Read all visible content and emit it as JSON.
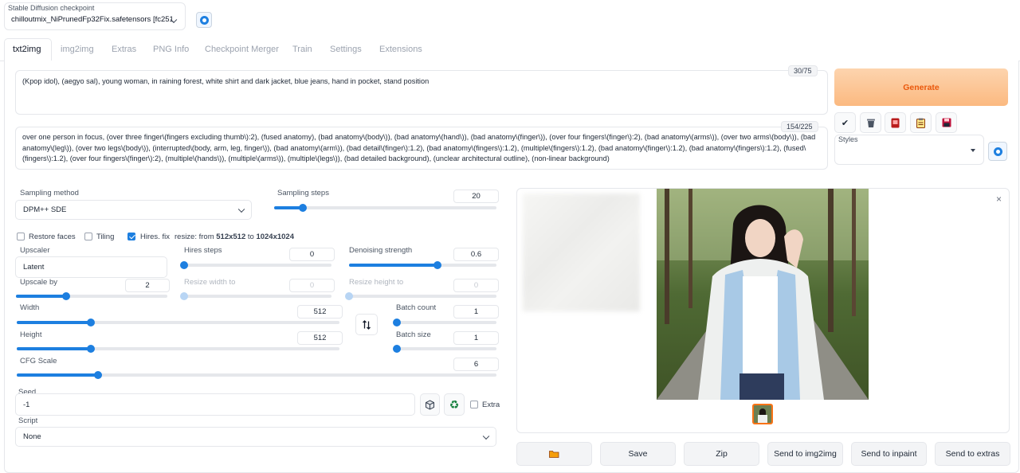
{
  "checkpoint": {
    "label": "Stable Diffusion checkpoint",
    "value": "chilloutmix_NiPrunedFp32Fix.safetensors [fc251"
  },
  "tabs": [
    "txt2img",
    "img2img",
    "Extras",
    "PNG Info",
    "Checkpoint Merger",
    "Train",
    "Settings",
    "Extensions"
  ],
  "prompt": {
    "text": "(Kpop idol), (aegyo sal),  young woman, in raining forest, white shirt and dark jacket, blue jeans, hand in pocket, stand position",
    "counter": "30/75"
  },
  "negative_prompt": {
    "text": "over one person in focus, (over three finger\\(fingers excluding thumb\\):2), (fused anatomy), (bad anatomy\\(body\\)), (bad anatomy\\(hand\\)), (bad anatomy\\(finger\\)), (over four fingers\\(finger\\):2), (bad anatomy\\(arms\\)), (over two arms\\(body\\)), (bad anatomy\\(leg\\)), (over two legs\\(body\\)), (interrupted\\(body, arm, leg, finger\\)), (bad anatomy\\(arm\\)), (bad detail\\(finger\\):1.2), (bad anatomy\\(fingers\\):1.2), (multiple\\(fingers\\):1.2), (bad anatomy\\(finger\\):1.2), (bad anatomy\\(fingers\\):1.2), (fused\\(fingers\\):1.2), (over four fingers\\(finger\\):2), (multiple\\(hands\\)), (multiple\\(arms\\)), (multiple\\(legs\\)), (bad detailed background), (unclear architectural outline), (non-linear background)",
    "counter": "154/225"
  },
  "generate_label": "Generate",
  "toolbar_icons": [
    "pencil-icon",
    "trash-icon",
    "red-card-icon",
    "clipboard-icon",
    "floppy-disk-icon"
  ],
  "styles": {
    "label": "Styles",
    "value": ""
  },
  "sampling": {
    "method_label": "Sampling method",
    "method": "DPM++ SDE",
    "steps_label": "Sampling steps",
    "steps": "20",
    "steps_fraction": 0.13
  },
  "checks": {
    "restore_faces": "Restore faces",
    "tiling": "Tiling",
    "hires_fix": "Hires. fix",
    "resize_prefix": "resize: from ",
    "resize_from": "512x512",
    "resize_to_word": " to ",
    "resize_to": "1024x1024"
  },
  "hires": {
    "upscaler_label": "Upscaler",
    "upscaler": "Latent",
    "steps_label": "Hires steps",
    "steps": "0",
    "steps_fraction": 0.0,
    "denoise_label": "Denoising strength",
    "denoise": "0.6",
    "denoise_fraction": 0.6,
    "upscale_by_label": "Upscale by",
    "upscale_by": "2",
    "upscale_by_fraction": 0.33,
    "resize_width_label": "Resize width to",
    "resize_width": "0",
    "resize_height_label": "Resize height to",
    "resize_height": "0"
  },
  "size": {
    "width_label": "Width",
    "width": "512",
    "width_fraction": 0.23,
    "height_label": "Height",
    "height": "512",
    "height_fraction": 0.23
  },
  "batch": {
    "count_label": "Batch count",
    "count": "1",
    "size_label": "Batch size",
    "size": "1"
  },
  "cfg": {
    "label": "CFG Scale",
    "value": "6",
    "fraction": 0.17
  },
  "seed": {
    "label": "Seed",
    "value": "-1",
    "extra_label": "Extra"
  },
  "script": {
    "label": "Script",
    "value": "None"
  },
  "output_buttons": [
    "Save",
    "Zip",
    "Send to img2img",
    "Send to inpaint",
    "Send to extras"
  ],
  "colors": {
    "accent": "#1d7fe0",
    "generate_text": "#ea580c"
  }
}
